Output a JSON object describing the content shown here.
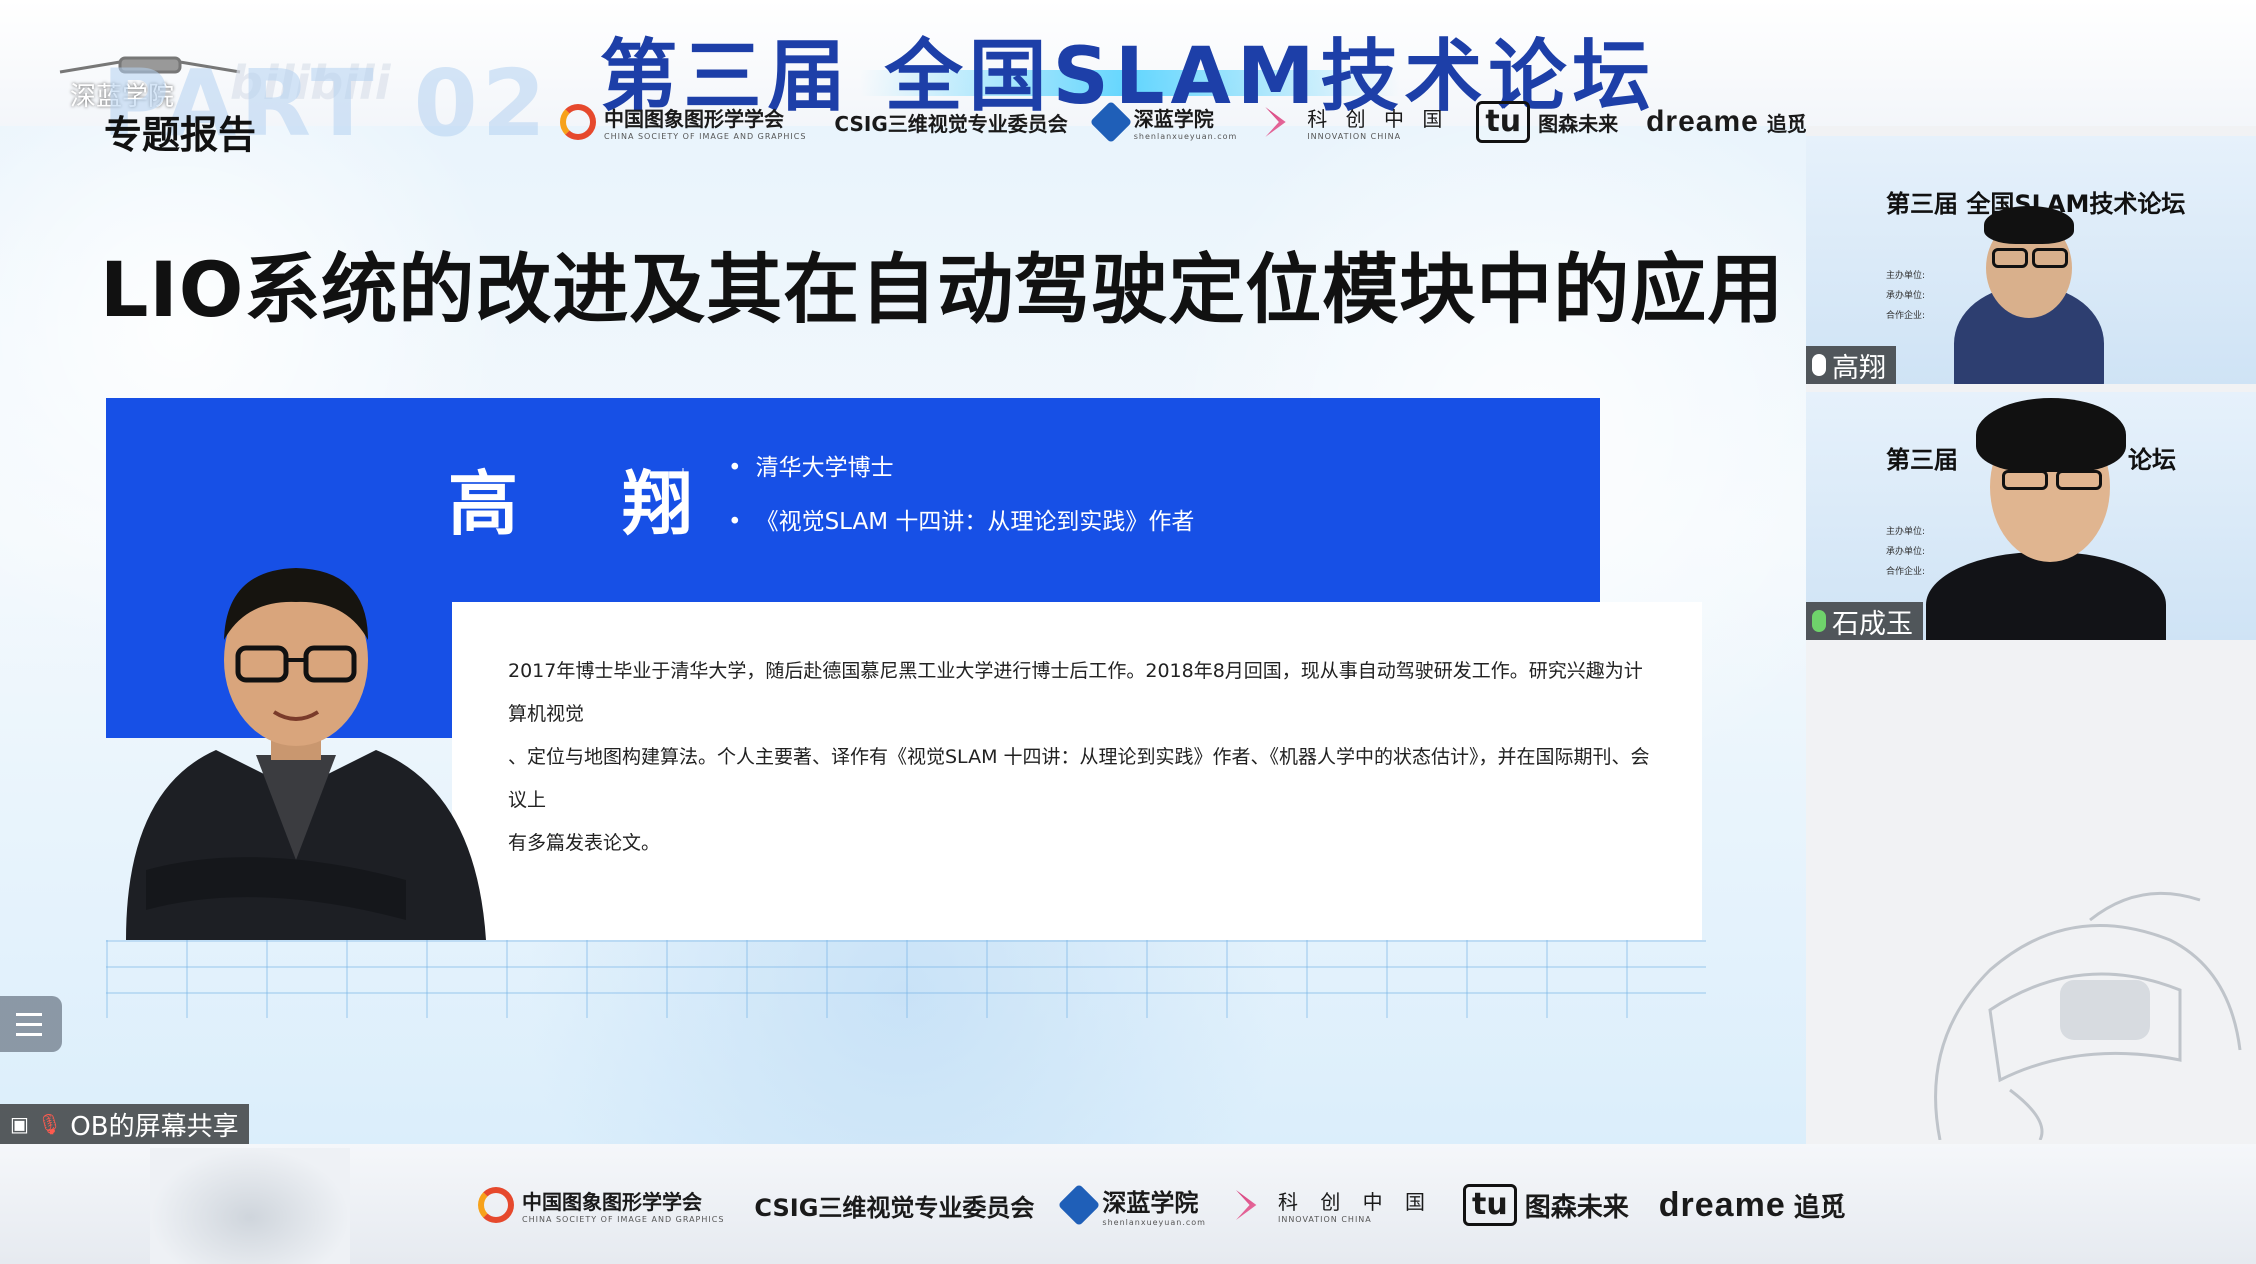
{
  "banner": {
    "title": "第三届  全国SLAM技术论坛",
    "watermark_text": "深蓝学院",
    "watermark_brand": "bilibili"
  },
  "slide": {
    "part_ghost": "PART 02",
    "part_label": "专题报告",
    "title": "LIO系统的改进及其在自动驾驶定位模块中的应用",
    "speaker": {
      "name": "高 翔",
      "credentials": [
        "清华大学博士",
        "《视觉SLAM 十四讲：从理论到实践》作者"
      ],
      "bio_lines": [
        "2017年博士毕业于清华大学，随后赴德国慕尼黑工业大学进行博士后工作。2018年8月回国，现从事自动驾驶研发工作。研究兴趣为计算机视觉",
        "、定位与地图构建算法。个人主要著、译作有《视觉SLAM 十四讲：从理论到实践》作者、《机器人学中的状态估计》，并在国际期刊、会议上",
        "有多篇发表论文。"
      ]
    }
  },
  "logos": {
    "csig_cn": "中国图象图形学学会",
    "csig_en": "CHINA SOCIETY OF IMAGE AND GRAPHICS",
    "csig3d": "CSIG三维视觉专业委员会",
    "shenlan": "深蓝学院",
    "shenlan_url": "shenlanxueyuan.com",
    "kechuang_cn": "科 创 中 国",
    "kechuang_en": "INNOVATION CHINA",
    "tu": "tu",
    "tusen": "图森未来",
    "dreame": "dreame",
    "dreame_cn": "追觅"
  },
  "screen_share": {
    "label": "OB的屏幕共享"
  },
  "participants": [
    {
      "name": "高翔",
      "tile_title": "第三届 全国SLAM技术论坛",
      "mic": "muted-white"
    },
    {
      "name": "石成玉",
      "tile_title": "第三届",
      "tile_title_right": "论坛",
      "mic": "active-green"
    }
  ],
  "tile_meta": [
    "主办单位:",
    "承办单位:",
    "合作企业:"
  ],
  "colors": {
    "banner_title": "#1d3fa8",
    "slide_blue_panel": "#1750e6",
    "mic_active": "#6fd36b"
  }
}
